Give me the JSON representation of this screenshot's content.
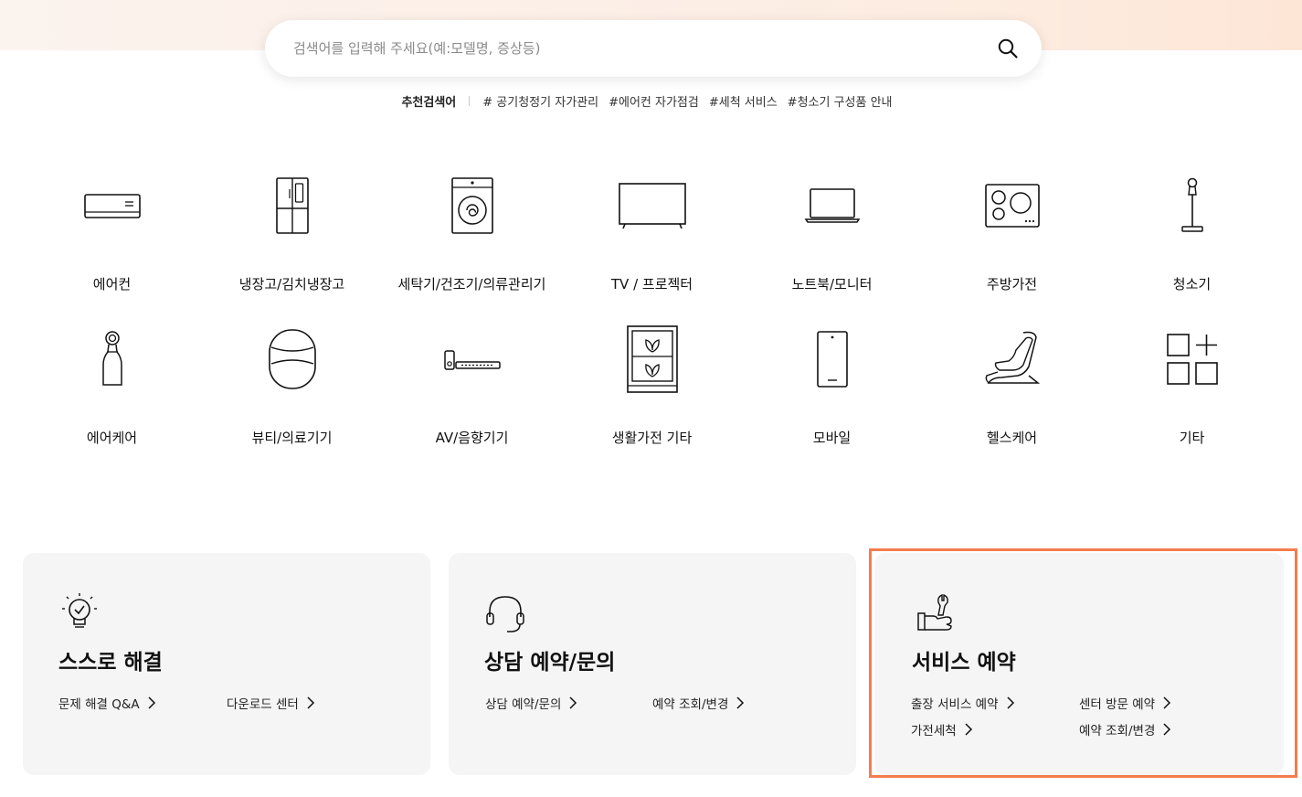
{
  "search": {
    "placeholder": "검색어를 입력해 주세요(예:모델명, 증상등)",
    "value": ""
  },
  "recommend": {
    "label": "추천검색어",
    "tags": [
      "# 공기청정기 자가관리",
      "#에어컨 자가점검",
      "#세척 서비스",
      "#청소기 구성품 안내"
    ]
  },
  "categories": [
    {
      "label": "에어컨",
      "icon": "air-conditioner-icon"
    },
    {
      "label": "냉장고/김치냉장고",
      "icon": "refrigerator-icon"
    },
    {
      "label": "세탁기/건조기/의류관리기",
      "icon": "washing-machine-icon"
    },
    {
      "label": "TV / 프로젝터",
      "icon": "tv-icon"
    },
    {
      "label": "노트북/모니터",
      "icon": "laptop-icon"
    },
    {
      "label": "주방가전",
      "icon": "cooktop-icon"
    },
    {
      "label": "청소기",
      "icon": "vacuum-icon"
    },
    {
      "label": "에어케어",
      "icon": "air-purifier-icon"
    },
    {
      "label": "뷰티/의료기기",
      "icon": "beauty-device-icon"
    },
    {
      "label": "AV/음향기기",
      "icon": "soundbar-icon"
    },
    {
      "label": "생활가전 기타",
      "icon": "plant-cultivator-icon"
    },
    {
      "label": "모바일",
      "icon": "mobile-icon"
    },
    {
      "label": "헬스케어",
      "icon": "massage-chair-icon"
    },
    {
      "label": "기타",
      "icon": "more-grid-icon"
    }
  ],
  "cards": {
    "self_solve": {
      "title": "스스로 해결",
      "icon": "lightbulb-check-icon",
      "links": [
        "문제 해결 Q&A",
        "다운로드 센터"
      ]
    },
    "consult": {
      "title": "상담 예약/문의",
      "icon": "headset-icon",
      "links": [
        "상담 예약/문의",
        "예약 조회/변경"
      ]
    },
    "service": {
      "title": "서비스 예약",
      "icon": "wrench-hand-icon",
      "links": [
        "출장 서비스 예약",
        "센터 방문 예약",
        "가전세척",
        "예약 조회/변경"
      ]
    }
  },
  "colors": {
    "highlight": "#f57c4e",
    "card_bg": "#f5f5f5"
  }
}
